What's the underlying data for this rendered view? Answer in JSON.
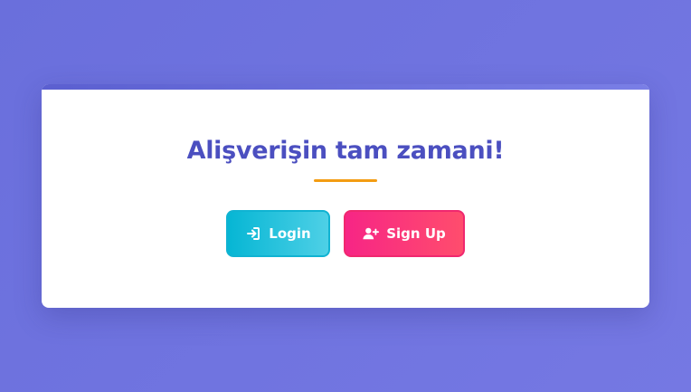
{
  "card": {
    "title": "Alişverişin tam zamani!"
  },
  "buttons": {
    "login": {
      "label": "Login",
      "icon": "sign-in-icon"
    },
    "signup": {
      "label": "Sign Up",
      "icon": "user-plus-icon"
    }
  },
  "colors": {
    "background": "#6a6fdc",
    "title": "#4b4fc0",
    "accent_underline": "#f39c12",
    "login_button": "#06b6d4",
    "signup_button": "#f72585"
  }
}
